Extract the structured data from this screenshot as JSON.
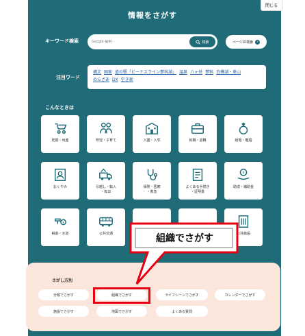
{
  "close_label": "閉じる",
  "title": "情報をさがす",
  "keyword": {
    "label": "キーワード検索",
    "placeholder": "Google 提供",
    "search_button": "検索",
    "pageid_button": "ページID検索"
  },
  "hot": {
    "label": "注目ワード",
    "words": [
      "構文",
      "国家",
      "道の駅「ビーナスライン蓼科湖」",
      "温泉",
      "八ヶ岳",
      "蓼科",
      "白樺湖・車山",
      "のらざあ",
      "DX",
      "空き家"
    ]
  },
  "situations": {
    "label": "こんなときは",
    "items": [
      {
        "label": "妊娠・出産",
        "icon": "stroller-icon"
      },
      {
        "label": "育児・子育て",
        "icon": "family-icon"
      },
      {
        "label": "入園・入学",
        "icon": "school-icon"
      },
      {
        "label": "就職・退職",
        "icon": "briefcase-icon"
      },
      {
        "label": "結婚・離婚",
        "icon": "ring-icon"
      },
      {
        "label": "おくやみ",
        "icon": "memorial-icon"
      },
      {
        "label": "引越し・転入\n・転出",
        "icon": "moving-truck-icon"
      },
      {
        "label": "保険・医療\n・救急",
        "icon": "stethoscope-icon"
      },
      {
        "label": "よくある手続き\n・証明書",
        "icon": "document-icon"
      },
      {
        "label": "助成・補助金",
        "icon": "subsidy-icon"
      },
      {
        "label": "税金・水道",
        "icon": "tax-water-icon"
      },
      {
        "label": "公共交通",
        "icon": "bus-icon"
      },
      {
        "label": "",
        "icon": "hidden-tile-1"
      },
      {
        "label": "",
        "icon": "hidden-tile-2"
      },
      {
        "label": "公共施設",
        "icon": "building-icon"
      }
    ]
  },
  "methods": {
    "label": "さがし方別",
    "items": [
      "分類でさがす",
      "組織でさがす",
      "ライフシーンでさがす",
      "カレンダーでさがす",
      "施設でさがす",
      "地図でさがす",
      "よくある質問"
    ]
  },
  "callout_text": "組織でさがす",
  "colors": {
    "panel": "#1f6b78",
    "accent": "#e60012",
    "method_bg": "#fbe6dc"
  }
}
